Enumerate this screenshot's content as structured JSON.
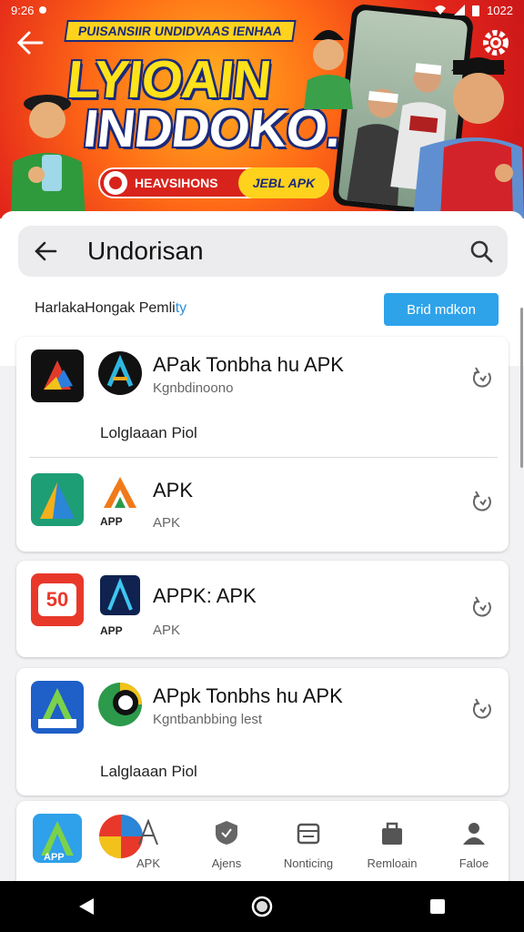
{
  "status_bar": {
    "time": "9:26",
    "battery": "1022"
  },
  "banner": {
    "ribbon": "PUISANSIIR UNDIDVAAS IENHAA",
    "title_line1": "LYIOAIN",
    "title_line2": "INDDOKO.!",
    "pill_text": "HEAVSIHONS",
    "pill_button": "JEBL APK"
  },
  "search": {
    "value": "Undorisan"
  },
  "filter": {
    "label_main": "HarlakaHongak Pemli",
    "label_accent": "ty",
    "button": "Brid mdkon"
  },
  "apps": [
    {
      "name": "APak Tonbha hu APK",
      "sub": "Kgnbdinoono",
      "tagline": "Lolglaaan Piol"
    },
    {
      "name": "APK",
      "sub": "APK",
      "logo2_caption": "APP"
    },
    {
      "name": "APPK: APK",
      "sub": "APK",
      "logo1_text": "50",
      "logo2_caption": "APP"
    },
    {
      "name": "APpk Tonbhs hu APK",
      "sub": "Kgntbanbbing lest",
      "tagline": "Lalglaaan Piol"
    },
    {
      "logo1_caption": "APP"
    }
  ],
  "bottom_nav": [
    {
      "label": "APK",
      "icon": "a-logo-icon"
    },
    {
      "label": "Ajens",
      "icon": "shield-icon"
    },
    {
      "label": "Nonticing",
      "icon": "box-icon"
    },
    {
      "label": "Remloain",
      "icon": "bag-icon"
    },
    {
      "label": "Faloe",
      "icon": "person-icon"
    }
  ],
  "colors": {
    "accent_blue": "#2ea3ea",
    "banner_red": "#e3261a",
    "banner_yellow": "#ffd21d",
    "navy": "#1b2a7a"
  }
}
